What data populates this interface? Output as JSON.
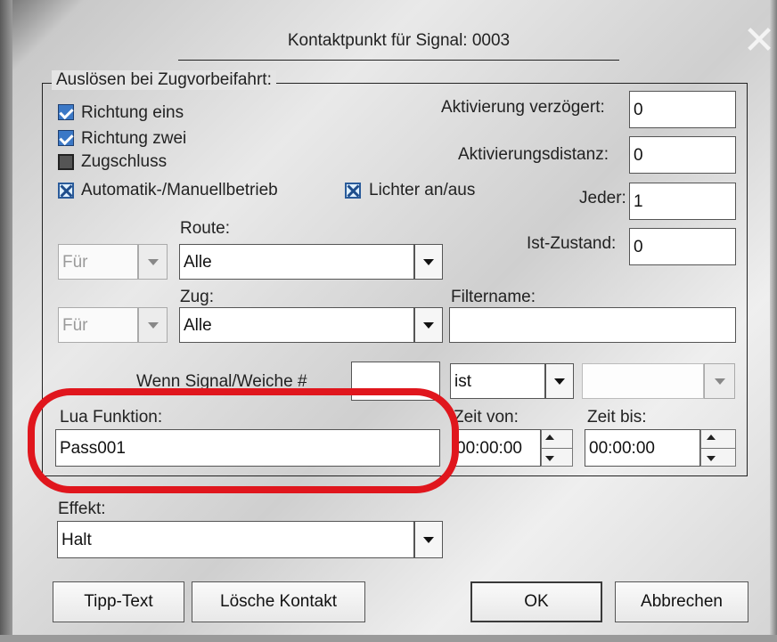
{
  "dialog": {
    "title": "Kontaktpunkt für Signal: 0003",
    "close_glyph": "✕"
  },
  "trigger_group": {
    "legend": "Auslösen bei Zugvorbeifahrt:",
    "checkboxes": [
      {
        "label": "Richtung eins",
        "state": "checked"
      },
      {
        "label": "Richtung zwei",
        "state": "checked"
      },
      {
        "label": "Zugschluss",
        "state": "indeterminate"
      },
      {
        "label": "Automatik-/Manuellbetrieb",
        "state": "x-checked"
      },
      {
        "label": "Lichter an/aus",
        "state": "x-checked"
      }
    ],
    "activation_delay": {
      "label": "Aktivierung verzögert:",
      "value": "0"
    },
    "activation_distance": {
      "label": "Aktivierungsdistanz:",
      "value": "0"
    },
    "every": {
      "label": "Jeder:",
      "value": "1"
    },
    "actual_state": {
      "label": "Ist-Zustand:",
      "value": "0"
    },
    "route": {
      "label": "Route:",
      "for_value": "Für",
      "value": "Alle"
    },
    "train": {
      "label": "Zug:",
      "for_value": "Für",
      "value": "Alle"
    },
    "filter": {
      "label": "Filtername:",
      "value": ""
    },
    "signal_condition": {
      "label": "Wenn Signal/Weiche #",
      "number": "",
      "operator": "ist",
      "state": ""
    },
    "lua": {
      "label": "Lua Funktion:",
      "value": "Pass001"
    },
    "time_from": {
      "label": "Zeit von:",
      "value": "00:00:00"
    },
    "time_to": {
      "label": "Zeit bis:",
      "value": "00:00:00"
    }
  },
  "effect": {
    "label": "Effekt:",
    "value": "Halt"
  },
  "buttons": {
    "tooltip": "Tipp-Text",
    "delete": "Lösche Kontakt",
    "ok": "OK",
    "cancel": "Abbrechen"
  },
  "colors": {
    "checkbox_blue": "#3b78c6",
    "annotation_red": "#e0161d"
  }
}
